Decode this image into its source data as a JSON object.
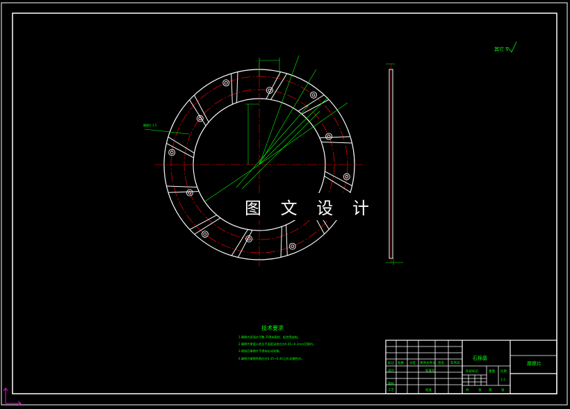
{
  "watermark": "图 文 设 计",
  "technical_requirements": {
    "title": "技术要求",
    "items": [
      "1.摩擦片表面应平整,不得有裂纹、起泡等缺陷。",
      "2.摩擦片厚度公差及平面度误差应在0.05~0.1mm范围内。",
      "3.铆接后摩擦片不得有松动现象。",
      "4.摩擦片摩擦系数应在0.35~0.40之间,耐磨性好。"
    ]
  },
  "roughness_note": "其它 ∇",
  "thickness_label": "摩擦片 1.5",
  "title_block": {
    "material": "石棉基",
    "part_name": "摩擦片",
    "header_cells": [
      "标记",
      "处数",
      "分区",
      "更改文件号",
      "签名",
      "年月日"
    ],
    "row_labels": [
      "设计",
      "审核",
      "工艺"
    ],
    "mid_labels": [
      "标准化",
      "批准"
    ],
    "stage_header": [
      "阶段标记",
      "重量",
      "比例"
    ],
    "scale": "1:1",
    "sheet_labels": [
      "共",
      "张",
      "第",
      "张"
    ]
  },
  "colors": {
    "background": "#000000",
    "outline": "#ffffff",
    "center_line": "#ff0000",
    "dimension": "#00ff00",
    "ucs": "#ff00ff"
  }
}
